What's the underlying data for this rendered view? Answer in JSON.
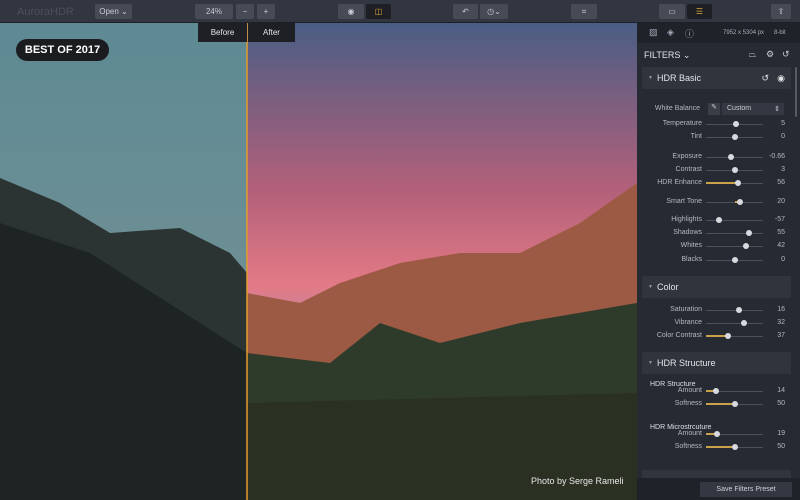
{
  "app": {
    "title": "AuroraHDR"
  },
  "toolbar": {
    "open": "Open ⌄",
    "zoom": "24%",
    "zoom_minus": "−",
    "zoom_plus": "+"
  },
  "compare": {
    "before": "Before",
    "after": "After"
  },
  "badge": "BEST OF 2017",
  "credit": "Photo by Serge Rameli",
  "panel": {
    "image_size": "7952 x 5304 px",
    "bit_depth": "8-bit",
    "filters_label": "FILTERS ⌄",
    "sections": {
      "hdr_basic": "HDR Basic",
      "color": "Color",
      "hdr_structure": "HDR Structure"
    },
    "white_balance": {
      "label": "White Balance",
      "value": "Custom"
    },
    "sliders": [
      {
        "label": "Temperature",
        "value": "5",
        "pos": 0.52
      },
      {
        "label": "Tint",
        "value": "0",
        "pos": 0.5
      },
      {
        "label": "Exposure",
        "value": "-0.66",
        "pos": 0.43
      },
      {
        "label": "Contrast",
        "value": "3",
        "pos": 0.51
      },
      {
        "label": "HDR Enhance",
        "value": "56",
        "pos": 0.56
      },
      {
        "label": "Smart Tone",
        "value": "20",
        "pos": 0.6
      },
      {
        "label": "Highlights",
        "value": "-57",
        "pos": 0.22
      },
      {
        "label": "Shadows",
        "value": "55",
        "pos": 0.76
      },
      {
        "label": "Whites",
        "value": "42",
        "pos": 0.7
      },
      {
        "label": "Blacks",
        "value": "0",
        "pos": 0.5
      },
      {
        "label": "Saturation",
        "value": "16",
        "pos": 0.58
      },
      {
        "label": "Vibrance",
        "value": "32",
        "pos": 0.66
      },
      {
        "label": "Color Contrast",
        "value": "37",
        "pos": 0.38
      },
      {
        "label": "Amount",
        "value": "14",
        "pos": 0.17
      },
      {
        "label": "Softness",
        "value": "50",
        "pos": 0.5
      },
      {
        "label": "Amount",
        "value": "19",
        "pos": 0.2
      },
      {
        "label": "Softness",
        "value": "50",
        "pos": 0.5
      }
    ],
    "structure_sub": "HDR Structure",
    "micro_sub": "HDR Microstrcuture",
    "save_preset": "Save Filters Preset"
  }
}
